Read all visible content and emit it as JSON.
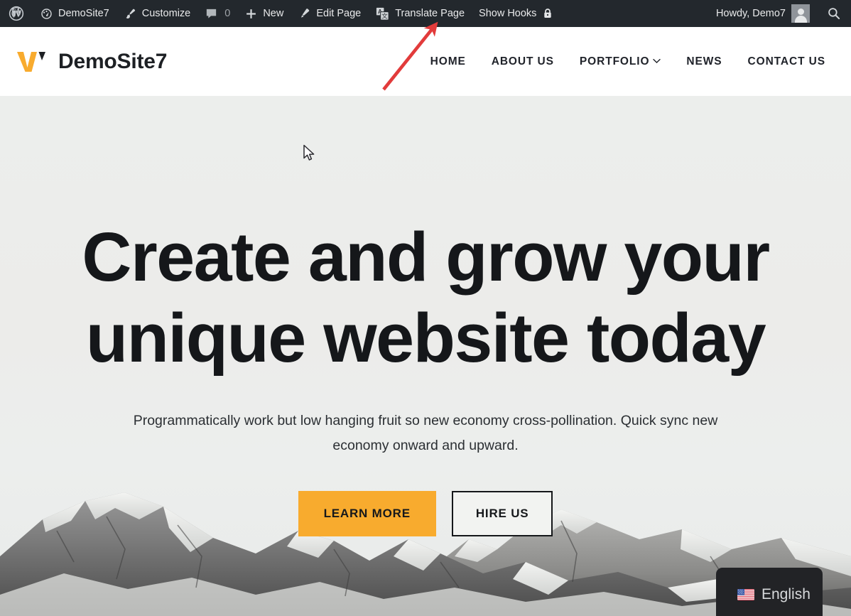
{
  "adminbar": {
    "wp_logo_icon": "wordpress-icon",
    "items": [
      {
        "icon": "dashboard-icon",
        "label": "DemoSite7"
      },
      {
        "icon": "paintbrush-icon",
        "label": "Customize"
      },
      {
        "icon": "comment-bubble-icon",
        "label": "0"
      },
      {
        "icon": "plus-icon",
        "label": "New"
      },
      {
        "icon": "pencil-icon",
        "label": "Edit Page"
      },
      {
        "icon": "translate-icon",
        "label": "Translate Page"
      },
      {
        "icon": "lock-icon",
        "label": "Show Hooks"
      }
    ],
    "howdy": "Howdy, Demo7",
    "avatar_icon": "avatar-icon",
    "search_icon": "search-icon",
    "background": "#23282d",
    "text_color": "#e9eaeb"
  },
  "header": {
    "logo_icon": "w-logo-icon",
    "site_title": "DemoSite7",
    "nav": [
      {
        "label": "HOME",
        "has_dropdown": false
      },
      {
        "label": "ABOUT US",
        "has_dropdown": false
      },
      {
        "label": "PORTFOLIO",
        "has_dropdown": true
      },
      {
        "label": "NEWS",
        "has_dropdown": false
      },
      {
        "label": "CONTACT US",
        "has_dropdown": false
      }
    ],
    "background": "#ffffff"
  },
  "hero": {
    "title": "Create and grow your unique website today",
    "subtitle": "Programmatically work but low hanging fruit so new economy cross-pollination. Quick sync new economy onward and upward.",
    "primary_button": "LEARN MORE",
    "secondary_button": "HIRE US",
    "primary_button_color": "#f8ab2e",
    "background_color": "#ecedeb"
  },
  "language_switcher": {
    "flag_icon": "us-flag-icon",
    "label": "English",
    "background": "#222326"
  },
  "annotation": {
    "arrow_color": "#e23b3b",
    "points_to": "Translate Page"
  },
  "cursor": {
    "icon": "mouse-pointer-icon"
  }
}
